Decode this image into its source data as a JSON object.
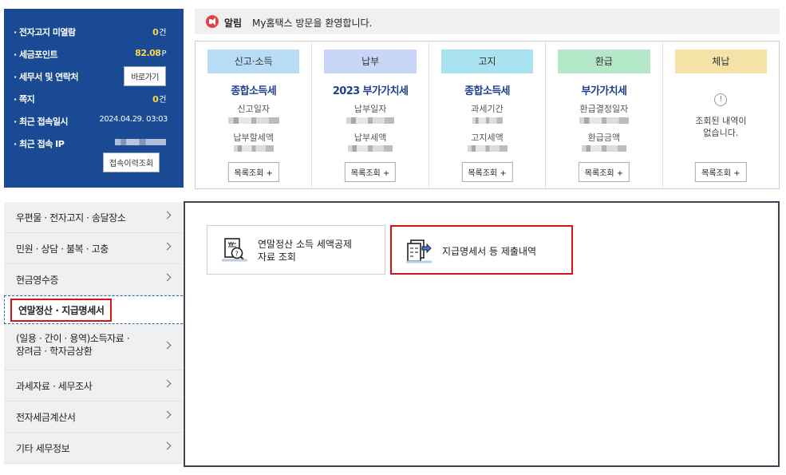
{
  "notice": {
    "tag": "알림",
    "text": "My홈택스 방문을 환영합니다."
  },
  "info": {
    "unread_notices": {
      "label": "· 전자고지 미열람",
      "value": "0",
      "unit": "건"
    },
    "tax_points": {
      "label": "· 세금포인트",
      "value": "82.08",
      "unit": "P"
    },
    "tax_office": {
      "label": "· 세무서 및 연락처",
      "button": "바로가기"
    },
    "messages": {
      "label": "· 쪽지",
      "value": "0",
      "unit": "건"
    },
    "last_login": {
      "label": "· 최근 접속일시",
      "value": "2024.04.29.  03:03"
    },
    "last_ip": {
      "label": "· 최근 접속 IP"
    },
    "history_button": "접속이력조회"
  },
  "cards": [
    {
      "tab": "신고·소득",
      "tab_color": "#b9dcf6",
      "title": "종합소득세",
      "label1": "신고일자",
      "label2": "납부할세액",
      "button": "목록조회 +"
    },
    {
      "tab": "납부",
      "tab_color": "#c7d6f7",
      "title": "2023 부가가치세",
      "label1": "납부일자",
      "label2": "납부세액",
      "button": "목록조회 +"
    },
    {
      "tab": "고지",
      "tab_color": "#a9e3ef",
      "title": "종합소득세",
      "label1": "과세기간",
      "label2": "고지세액",
      "button": "목록조회 +"
    },
    {
      "tab": "환급",
      "tab_color": "#b5e7c9",
      "title": "부가가치세",
      "label1": "환급결정일자",
      "label2": "환급금액",
      "button": "목록조회 +"
    },
    {
      "tab": "체납",
      "tab_color": "#f5e2a6",
      "empty_line1": "조회된 내역이",
      "empty_line2": "없습니다.",
      "button": "목록조회 +"
    }
  ],
  "menu": [
    "우편물 · 전자고지 · 송달장소",
    "민원 · 상담 · 불복 · 고충",
    "현금영수증",
    "연말정산 · 지급명세서",
    "(일용 · 간이 · 용역)소득자료 ·",
    "장려금 · 학자금상환",
    "과세자료 · 세무조사",
    "전자세금계산서",
    "기타 세무정보"
  ],
  "options": {
    "deduction_line1": "연말정산 소득 세액공제",
    "deduction_line2": "자료 조회",
    "payment_statement": "지급명세서 등 제출내역"
  }
}
